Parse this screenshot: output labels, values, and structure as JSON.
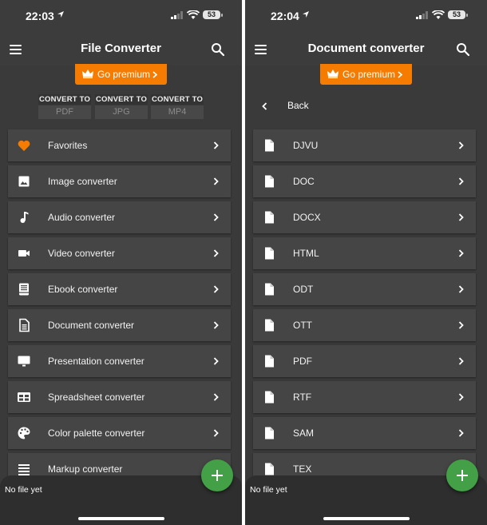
{
  "colors": {
    "accent": "#f57c00",
    "fab": "#43a047",
    "background": "#3a3a3a",
    "card": "#454545"
  },
  "left": {
    "status": {
      "time": "22:03",
      "battery": "53"
    },
    "appbar": {
      "title": "File Converter",
      "menu_icon": "hamburger-icon",
      "search_icon": "search-icon"
    },
    "premium": {
      "label": "Go premium",
      "icon": "crown-icon"
    },
    "convert_to": [
      {
        "label": "CONVERT TO",
        "value": "PDF"
      },
      {
        "label": "CONVERT TO",
        "value": "JPG"
      },
      {
        "label": "CONVERT TO",
        "value": "MP4"
      }
    ],
    "items": [
      {
        "label": "Favorites",
        "icon": "heart-icon"
      },
      {
        "label": "Image converter",
        "icon": "image-icon"
      },
      {
        "label": "Audio converter",
        "icon": "music-note-icon"
      },
      {
        "label": "Video converter",
        "icon": "video-camera-icon"
      },
      {
        "label": "Ebook converter",
        "icon": "book-icon"
      },
      {
        "label": "Document converter",
        "icon": "document-icon"
      },
      {
        "label": "Presentation converter",
        "icon": "monitor-icon"
      },
      {
        "label": "Spreadsheet converter",
        "icon": "table-icon"
      },
      {
        "label": "Color palette converter",
        "icon": "palette-icon"
      },
      {
        "label": "Markup converter",
        "icon": "list-lines-icon"
      }
    ],
    "bottom": {
      "status": "No file yet"
    }
  },
  "right": {
    "status": {
      "time": "22:04",
      "battery": "53"
    },
    "appbar": {
      "title": "Document converter",
      "menu_icon": "hamburger-icon",
      "search_icon": "search-icon"
    },
    "premium": {
      "label": "Go premium",
      "icon": "crown-icon"
    },
    "back": {
      "label": "Back"
    },
    "items": [
      {
        "label": "DJVU",
        "icon": "file-icon"
      },
      {
        "label": "DOC",
        "icon": "file-icon"
      },
      {
        "label": "DOCX",
        "icon": "file-icon"
      },
      {
        "label": "HTML",
        "icon": "file-icon"
      },
      {
        "label": "ODT",
        "icon": "file-icon"
      },
      {
        "label": "OTT",
        "icon": "file-icon"
      },
      {
        "label": "PDF",
        "icon": "file-icon"
      },
      {
        "label": "RTF",
        "icon": "file-icon"
      },
      {
        "label": "SAM",
        "icon": "file-icon"
      },
      {
        "label": "TEX",
        "icon": "file-icon"
      }
    ],
    "bottom": {
      "status": "No file yet"
    }
  }
}
